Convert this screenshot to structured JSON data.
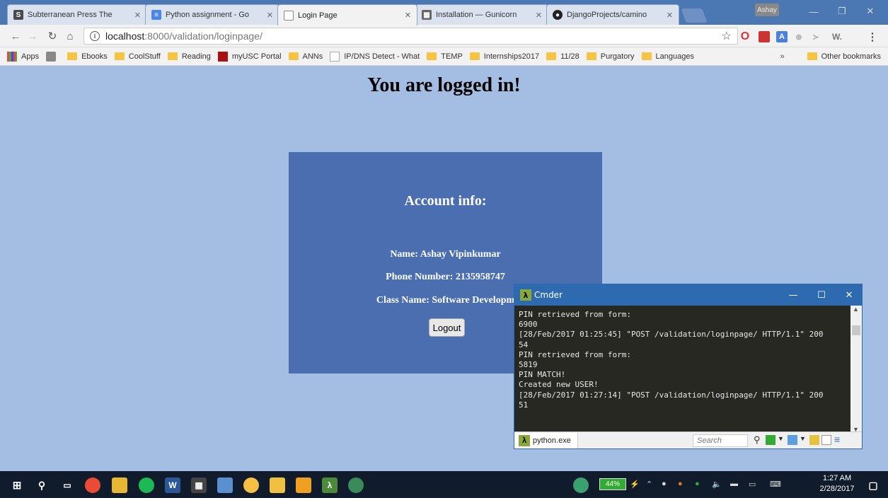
{
  "browser": {
    "tabs": [
      {
        "label": "Subterranean Press The",
        "favicon": "S",
        "favicon_color": "#4a4a4a"
      },
      {
        "label": "Python assignment - Go",
        "favicon": "docs-icon",
        "favicon_color": "#4a86e8"
      },
      {
        "label": "Login Page",
        "favicon": "page-icon",
        "favicon_color": "#888888"
      },
      {
        "label": "Installation — Gunicorn",
        "favicon": "gunicorn-icon",
        "favicon_color": "#666666"
      },
      {
        "label": "DjangoProjects/camino",
        "favicon": "github-icon",
        "favicon_color": "#222222"
      }
    ],
    "profile_name": "Ashay",
    "url_host": "localhost",
    "url_path": ":8000/validation/loginpage/",
    "bookmarks": [
      "Apps",
      "Ebooks",
      "CoolStuff",
      "Reading",
      "myUSC Portal",
      "ANNs",
      "IP/DNS Detect - What",
      "TEMP",
      "Internships2017",
      "11/28",
      "Purgatory",
      "Languages"
    ],
    "bookmarks_overflow": "»",
    "other_bookmarks": "Other bookmarks"
  },
  "page": {
    "heading": "You are logged in!",
    "card_title": "Account info:",
    "name_line": "Name: Ashay Vipinkumar",
    "phone_line": "Phone Number: 2135958747",
    "class_line": "Class Name: Software Developm",
    "logout_label": "Logout",
    "card_color": "#4a6eaf",
    "background_color": "#a4bde2"
  },
  "cmder": {
    "title": "Cmder",
    "console_lines": [
      "PIN retrieved from form:",
      "6900",
      "[28/Feb/2017 01:25:45] \"POST /validation/loginpage/ HTTP/1.1\" 200",
      "54",
      "PIN retrieved from form:",
      "5819",
      "PIN MATCH!",
      "Created new USER!",
      "[28/Feb/2017 01:27:14] \"POST /validation/loginpage/ HTTP/1.1\" 200",
      "51"
    ],
    "tab_label": "python.exe",
    "search_placeholder": "Search"
  },
  "taskbar": {
    "battery": "44%",
    "time": "1:27 AM",
    "date": "2/28/2017"
  }
}
